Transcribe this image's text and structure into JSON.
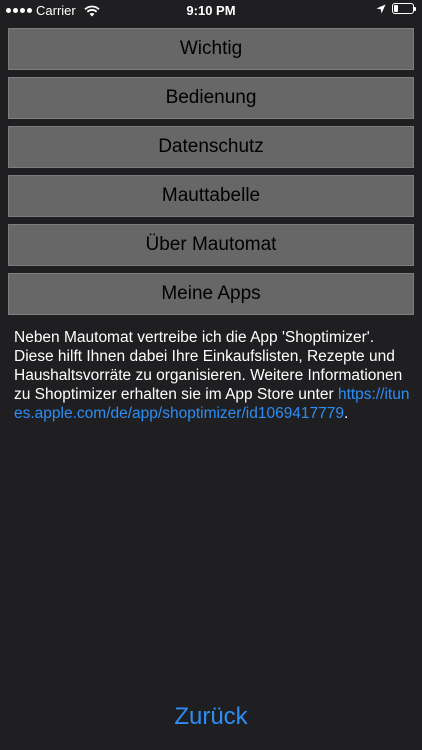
{
  "status_bar": {
    "carrier": "Carrier",
    "time": "9:10 PM",
    "battery_level": 0.2
  },
  "menu": {
    "items": [
      {
        "label": "Wichtig"
      },
      {
        "label": "Bedienung"
      },
      {
        "label": "Datenschutz"
      },
      {
        "label": "Mauttabelle"
      },
      {
        "label": "Über Mautomat"
      },
      {
        "label": "Meine Apps"
      }
    ]
  },
  "info": {
    "text": "Neben Mautomat vertreibe ich die App 'Shoptimizer'. Diese hilft Ihnen dabei Ihre Einkaufslisten, Rezepte und Haushaltsvorräte zu organisieren. Weitere Informationen zu Shoptimizer erhalten sie im App Store unter ",
    "link": "https://itunes.apple.com/de/app/shoptimizer/id1069417779",
    "suffix": "."
  },
  "footer": {
    "back_label": "Zurück"
  },
  "colors": {
    "background": "#1f1f21",
    "button_bg": "#676767",
    "link": "#2c8ef5"
  }
}
